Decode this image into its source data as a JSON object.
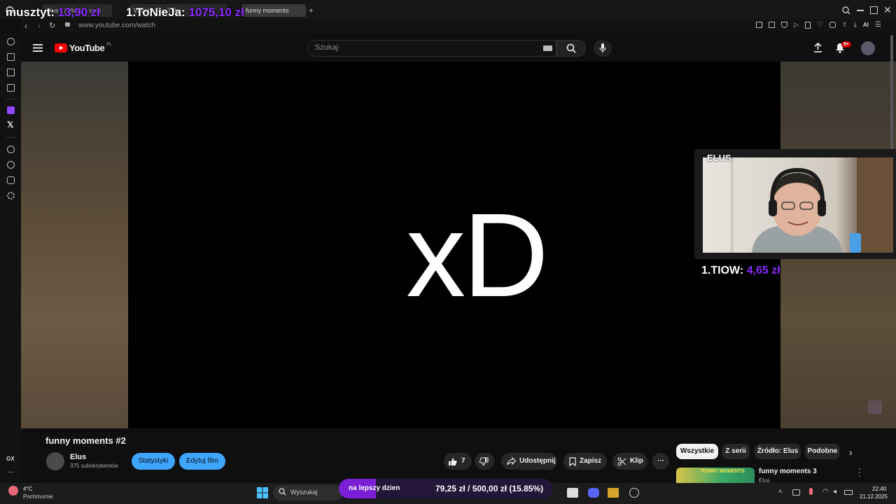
{
  "overlay": {
    "left_label": "musztyt:",
    "left_amount": "13,90 zł",
    "top_donor": "1.ToNieJa:",
    "top_amount": "1075,10 zł",
    "cam_donor": "1.TIOW:",
    "cam_amount": "4,65 zł",
    "cam_name": "ELUS"
  },
  "browser": {
    "url": "www.youtube.com/watch",
    "tabs": [
      "Elus - (TALK) - com",
      "Watch - YouTube",
      "funny moments"
    ]
  },
  "youtube": {
    "logo_text": "YouTube",
    "logo_region": "PL",
    "search_placeholder": "Szukaj",
    "notification_badge": "9+"
  },
  "player": {
    "frame_text": "xD"
  },
  "video": {
    "title": "funny moments #2",
    "channel": "Elus",
    "subscribers": "375 subskrybentów",
    "stats_button": "Statystyki",
    "edit_button": "Edytuj film",
    "like_count": "7",
    "share_label": "Udostępnij",
    "save_label": "Zapisz",
    "clip_label": "Klip"
  },
  "chips": [
    "Wszystkie",
    "Z serii",
    "Źródło: Elus",
    "Podobne"
  ],
  "recommendation": {
    "title": "funny moments 3",
    "channel": "Elus",
    "thumb_text": "FUNNY MOMENTS"
  },
  "taskbar": {
    "weather_temp": "4°C",
    "weather_desc": "Pochmurnie",
    "search_label": "Wyszukaj",
    "goal_label": "na lepszy dzien",
    "goal_amount": "79,25 zł / 500,00 zł (15.85%)",
    "goal_fraction": 0.1585,
    "time": "22:40",
    "date": "21.12.2025"
  },
  "colors": {
    "accent_purple": "#8b2cff",
    "youtube_red": "#ff0000",
    "blue_button": "#3ea6ff"
  }
}
